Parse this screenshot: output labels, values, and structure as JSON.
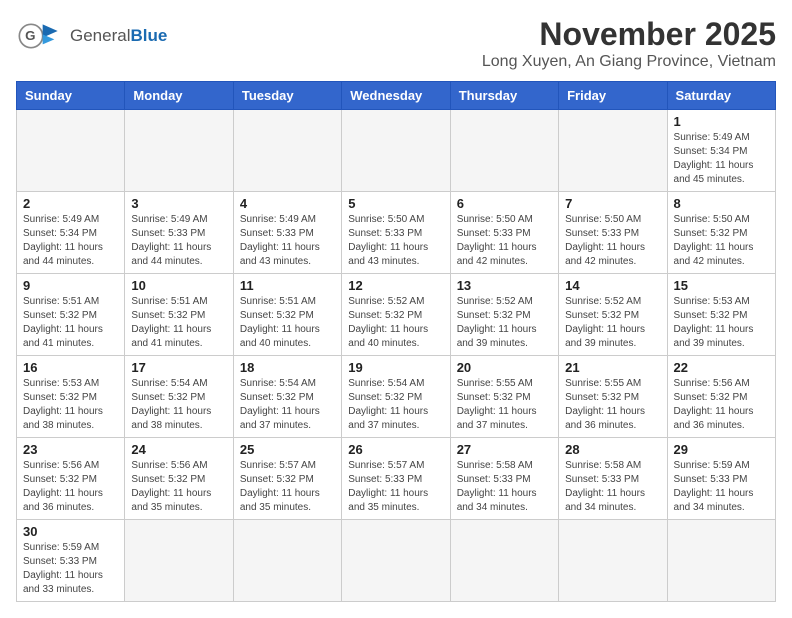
{
  "header": {
    "logo_general": "General",
    "logo_blue": "Blue",
    "month_title": "November 2025",
    "subtitle": "Long Xuyen, An Giang Province, Vietnam"
  },
  "weekdays": [
    "Sunday",
    "Monday",
    "Tuesday",
    "Wednesday",
    "Thursday",
    "Friday",
    "Saturday"
  ],
  "weeks": [
    [
      {
        "day": "",
        "info": ""
      },
      {
        "day": "",
        "info": ""
      },
      {
        "day": "",
        "info": ""
      },
      {
        "day": "",
        "info": ""
      },
      {
        "day": "",
        "info": ""
      },
      {
        "day": "",
        "info": ""
      },
      {
        "day": "1",
        "info": "Sunrise: 5:49 AM\nSunset: 5:34 PM\nDaylight: 11 hours\nand 45 minutes."
      }
    ],
    [
      {
        "day": "2",
        "info": "Sunrise: 5:49 AM\nSunset: 5:34 PM\nDaylight: 11 hours\nand 44 minutes."
      },
      {
        "day": "3",
        "info": "Sunrise: 5:49 AM\nSunset: 5:33 PM\nDaylight: 11 hours\nand 44 minutes."
      },
      {
        "day": "4",
        "info": "Sunrise: 5:49 AM\nSunset: 5:33 PM\nDaylight: 11 hours\nand 43 minutes."
      },
      {
        "day": "5",
        "info": "Sunrise: 5:50 AM\nSunset: 5:33 PM\nDaylight: 11 hours\nand 43 minutes."
      },
      {
        "day": "6",
        "info": "Sunrise: 5:50 AM\nSunset: 5:33 PM\nDaylight: 11 hours\nand 42 minutes."
      },
      {
        "day": "7",
        "info": "Sunrise: 5:50 AM\nSunset: 5:33 PM\nDaylight: 11 hours\nand 42 minutes."
      },
      {
        "day": "8",
        "info": "Sunrise: 5:50 AM\nSunset: 5:32 PM\nDaylight: 11 hours\nand 42 minutes."
      }
    ],
    [
      {
        "day": "9",
        "info": "Sunrise: 5:51 AM\nSunset: 5:32 PM\nDaylight: 11 hours\nand 41 minutes."
      },
      {
        "day": "10",
        "info": "Sunrise: 5:51 AM\nSunset: 5:32 PM\nDaylight: 11 hours\nand 41 minutes."
      },
      {
        "day": "11",
        "info": "Sunrise: 5:51 AM\nSunset: 5:32 PM\nDaylight: 11 hours\nand 40 minutes."
      },
      {
        "day": "12",
        "info": "Sunrise: 5:52 AM\nSunset: 5:32 PM\nDaylight: 11 hours\nand 40 minutes."
      },
      {
        "day": "13",
        "info": "Sunrise: 5:52 AM\nSunset: 5:32 PM\nDaylight: 11 hours\nand 39 minutes."
      },
      {
        "day": "14",
        "info": "Sunrise: 5:52 AM\nSunset: 5:32 PM\nDaylight: 11 hours\nand 39 minutes."
      },
      {
        "day": "15",
        "info": "Sunrise: 5:53 AM\nSunset: 5:32 PM\nDaylight: 11 hours\nand 39 minutes."
      }
    ],
    [
      {
        "day": "16",
        "info": "Sunrise: 5:53 AM\nSunset: 5:32 PM\nDaylight: 11 hours\nand 38 minutes."
      },
      {
        "day": "17",
        "info": "Sunrise: 5:54 AM\nSunset: 5:32 PM\nDaylight: 11 hours\nand 38 minutes."
      },
      {
        "day": "18",
        "info": "Sunrise: 5:54 AM\nSunset: 5:32 PM\nDaylight: 11 hours\nand 37 minutes."
      },
      {
        "day": "19",
        "info": "Sunrise: 5:54 AM\nSunset: 5:32 PM\nDaylight: 11 hours\nand 37 minutes."
      },
      {
        "day": "20",
        "info": "Sunrise: 5:55 AM\nSunset: 5:32 PM\nDaylight: 11 hours\nand 37 minutes."
      },
      {
        "day": "21",
        "info": "Sunrise: 5:55 AM\nSunset: 5:32 PM\nDaylight: 11 hours\nand 36 minutes."
      },
      {
        "day": "22",
        "info": "Sunrise: 5:56 AM\nSunset: 5:32 PM\nDaylight: 11 hours\nand 36 minutes."
      }
    ],
    [
      {
        "day": "23",
        "info": "Sunrise: 5:56 AM\nSunset: 5:32 PM\nDaylight: 11 hours\nand 36 minutes."
      },
      {
        "day": "24",
        "info": "Sunrise: 5:56 AM\nSunset: 5:32 PM\nDaylight: 11 hours\nand 35 minutes."
      },
      {
        "day": "25",
        "info": "Sunrise: 5:57 AM\nSunset: 5:32 PM\nDaylight: 11 hours\nand 35 minutes."
      },
      {
        "day": "26",
        "info": "Sunrise: 5:57 AM\nSunset: 5:33 PM\nDaylight: 11 hours\nand 35 minutes."
      },
      {
        "day": "27",
        "info": "Sunrise: 5:58 AM\nSunset: 5:33 PM\nDaylight: 11 hours\nand 34 minutes."
      },
      {
        "day": "28",
        "info": "Sunrise: 5:58 AM\nSunset: 5:33 PM\nDaylight: 11 hours\nand 34 minutes."
      },
      {
        "day": "29",
        "info": "Sunrise: 5:59 AM\nSunset: 5:33 PM\nDaylight: 11 hours\nand 34 minutes."
      }
    ],
    [
      {
        "day": "30",
        "info": "Sunrise: 5:59 AM\nSunset: 5:33 PM\nDaylight: 11 hours\nand 33 minutes."
      },
      {
        "day": "",
        "info": ""
      },
      {
        "day": "",
        "info": ""
      },
      {
        "day": "",
        "info": ""
      },
      {
        "day": "",
        "info": ""
      },
      {
        "day": "",
        "info": ""
      },
      {
        "day": "",
        "info": ""
      }
    ]
  ]
}
